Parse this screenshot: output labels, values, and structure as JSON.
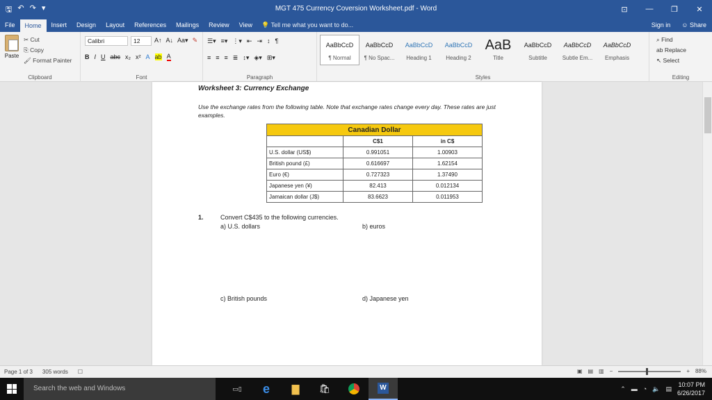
{
  "window": {
    "title": "MGT 475 Currency Coversion Worksheet.pdf - Word",
    "controls": {
      "ribbon_display": "⊡",
      "minimize": "—",
      "restore": "❐",
      "close": "✕"
    }
  },
  "qat": {
    "save": "🖫",
    "undo": "↶",
    "redo": "↷",
    "more": "▾"
  },
  "tabs": [
    "File",
    "Home",
    "Insert",
    "Design",
    "Layout",
    "References",
    "Mailings",
    "Review",
    "View"
  ],
  "tell_me": "Tell me what you want to do...",
  "account": {
    "sign_in": "Sign in",
    "share": "Share"
  },
  "ribbon": {
    "clipboard": {
      "paste": "Paste",
      "cut": "Cut",
      "copy": "Copy",
      "format_painter": "Format Painter",
      "label": "Clipboard"
    },
    "font": {
      "name": "Calibri",
      "size": "12",
      "label": "Font"
    },
    "paragraph": {
      "label": "Paragraph"
    },
    "styles": {
      "label": "Styles",
      "items": [
        {
          "sample": "AaBbCcD",
          "name": "¶ Normal"
        },
        {
          "sample": "AaBbCcD",
          "name": "¶ No Spac..."
        },
        {
          "sample": "AaBbCcD",
          "name": "Heading 1"
        },
        {
          "sample": "AaBbCcD",
          "name": "Heading 2"
        },
        {
          "sample": "AaB",
          "name": "Title"
        },
        {
          "sample": "AaBbCcD",
          "name": "Subtitle"
        },
        {
          "sample": "AaBbCcD",
          "name": "Subtle Em..."
        },
        {
          "sample": "AaBbCcD",
          "name": "Emphasis"
        }
      ]
    },
    "editing": {
      "find": "Find",
      "replace": "Replace",
      "select": "Select",
      "label": "Editing"
    }
  },
  "document": {
    "heading": "Worksheet 3: Currency Exchange",
    "intro": "Use the exchange rates from the following table. Note that exchange rates change every day. These rates are just examples.",
    "table": {
      "caption": "Canadian Dollar",
      "headers": [
        "",
        "C$1",
        "in C$"
      ],
      "rows": [
        [
          "U.S. dollar (US$)",
          "0.991051",
          "1.00903"
        ],
        [
          "British pound (£)",
          "0.616697",
          "1.62154"
        ],
        [
          "Euro (€)",
          "0.727323",
          "1.37490"
        ],
        [
          "Japanese yen (¥)",
          "82.413",
          "0.012134"
        ],
        [
          "Jamaican dollar (J$)",
          "83.6623",
          "0.011953"
        ]
      ]
    },
    "question": {
      "number": "1.",
      "text": "Convert C$435 to the following currencies.",
      "parts": [
        "a) U.S. dollars",
        "b) euros",
        "c) British pounds",
        "d) Japanese yen"
      ]
    }
  },
  "status": {
    "page": "Page 1 of 3",
    "words": "305 words",
    "zoom": "88%"
  },
  "taskbar": {
    "search": "Search the web and Windows",
    "time": "10:07 PM",
    "date": "6/26/2017"
  }
}
